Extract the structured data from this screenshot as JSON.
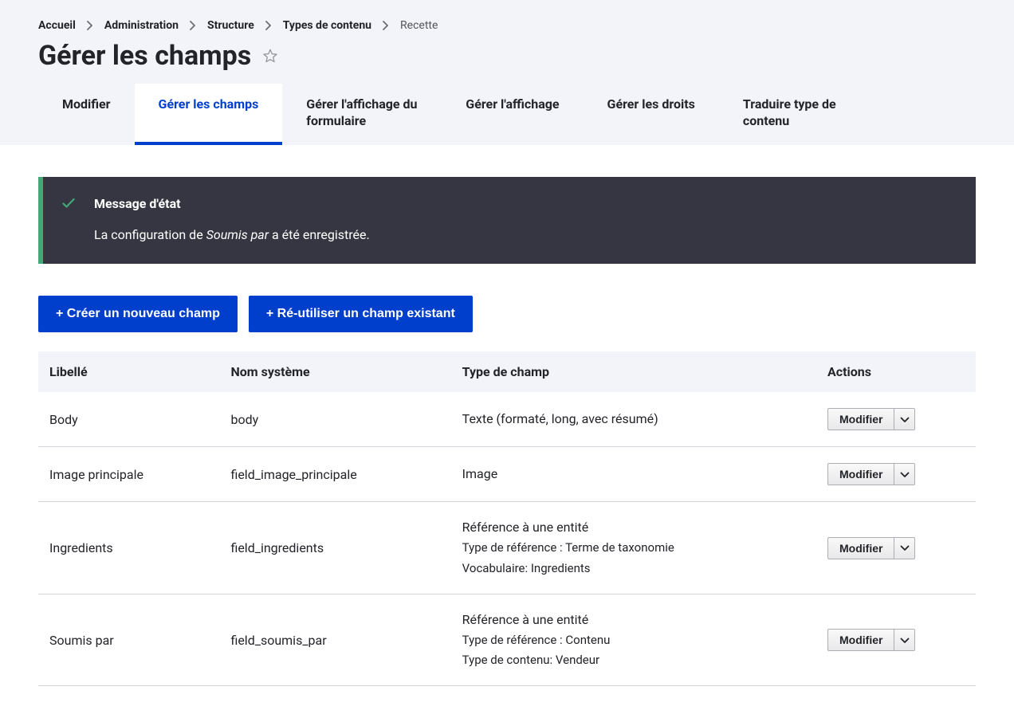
{
  "breadcrumb": {
    "items": [
      {
        "label": "Accueil"
      },
      {
        "label": "Administration"
      },
      {
        "label": "Structure"
      },
      {
        "label": "Types de contenu"
      }
    ],
    "current": "Recette"
  },
  "page_title": "Gérer les champs",
  "tabs": [
    {
      "label": "Modifier",
      "active": false
    },
    {
      "label": "Gérer les champs",
      "active": true
    },
    {
      "label": "Gérer l'affichage du formulaire",
      "active": false
    },
    {
      "label": "Gérer l'affichage",
      "active": false
    },
    {
      "label": "Gérer les droits",
      "active": false
    },
    {
      "label": "Traduire type de contenu",
      "active": false
    }
  ],
  "status": {
    "title": "Message d'état",
    "text_prefix": "La configuration de ",
    "text_em": "Soumis par",
    "text_suffix": " a été enregistrée."
  },
  "buttons": {
    "create": "+ Créer un nouveau champ",
    "reuse": "+ Ré-utiliser un champ existant"
  },
  "table": {
    "headers": {
      "label": "Libellé",
      "machine": "Nom système",
      "type": "Type de champ",
      "actions": "Actions"
    },
    "action_label": "Modifier",
    "rows": [
      {
        "label": "Body",
        "machine": "body",
        "type": "Texte (formaté, long, avec résumé)",
        "sub": []
      },
      {
        "label": "Image principale",
        "machine": "field_image_principale",
        "type": "Image",
        "sub": []
      },
      {
        "label": "Ingredients",
        "machine": "field_ingredients",
        "type": "Référence à une entité",
        "sub": [
          "Type de référence : Terme de taxonomie",
          "Vocabulaire: Ingredients"
        ]
      },
      {
        "label": "Soumis par",
        "machine": "field_soumis_par",
        "type": "Référence à une entité",
        "sub": [
          "Type de référence : Contenu",
          "Type de contenu: Vendeur"
        ]
      }
    ]
  }
}
